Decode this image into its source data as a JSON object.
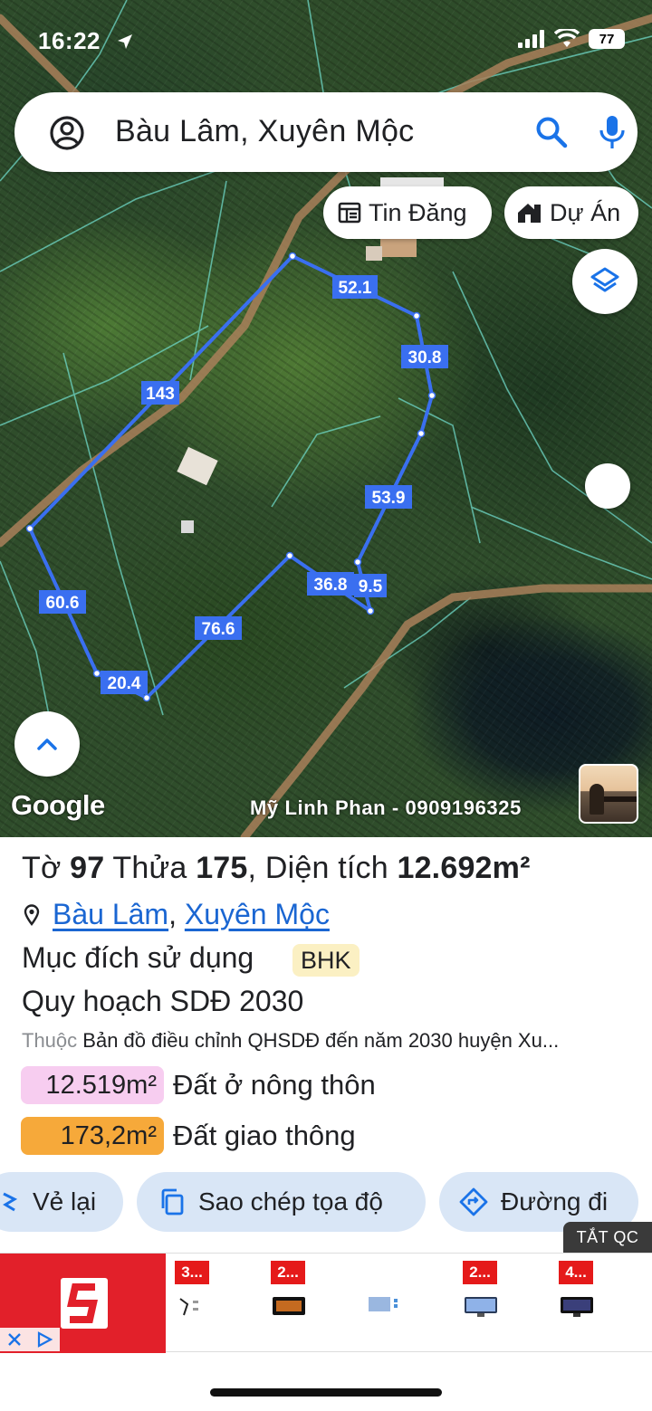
{
  "status_bar": {
    "time": "16:22",
    "battery": "77"
  },
  "search": {
    "query": "Bàu Lâm, Xuyên Mộc"
  },
  "chips": {
    "news": "Tin Đăng",
    "projects": "Dự Án"
  },
  "map": {
    "google_label": "Google",
    "watermark": "Mỹ Linh Phan - 0909196325",
    "edge_labels": [
      "52.1",
      "30.8",
      "143",
      "53.9",
      "36.8",
      "9.5",
      "60.6",
      "76.6",
      "20.4"
    ]
  },
  "parcel": {
    "sheet_label": "Tờ",
    "sheet_no": "97",
    "plot_label": "Thửa",
    "plot_no": "175",
    "area_label": "Diện tích",
    "area_value": "12.692m²",
    "location_commune": "Bàu Lâm",
    "location_district": "Xuyên Mộc",
    "purpose_label": "Mục đích sử dụng",
    "purpose_code": "BHK",
    "plan_title": "Quy hoạch SDĐ 2030",
    "belong_label": "Thuộc",
    "belong_text": "Bản đồ điều chỉnh QHSDĐ đến năm 2030 huyện Xu...",
    "zones": [
      {
        "area": "12.519m²",
        "label": "Đất ở nông thôn",
        "color": "#f7cdf0"
      },
      {
        "area": "173,2m²",
        "label": "Đất giao thông",
        "color": "#f6a93a"
      }
    ]
  },
  "actions": {
    "redraw": "Vẻ lại",
    "copy_coords": "Sao chép tọa độ",
    "directions": "Đường đi"
  },
  "ad": {
    "off_label": "TẮT QC",
    "item_tags": [
      "3...",
      "2...",
      "2...",
      "4..."
    ]
  },
  "colors": {
    "parcel_line": "#3a6ff0",
    "link": "#1a66d2",
    "action_bg": "#d9e6f6"
  }
}
